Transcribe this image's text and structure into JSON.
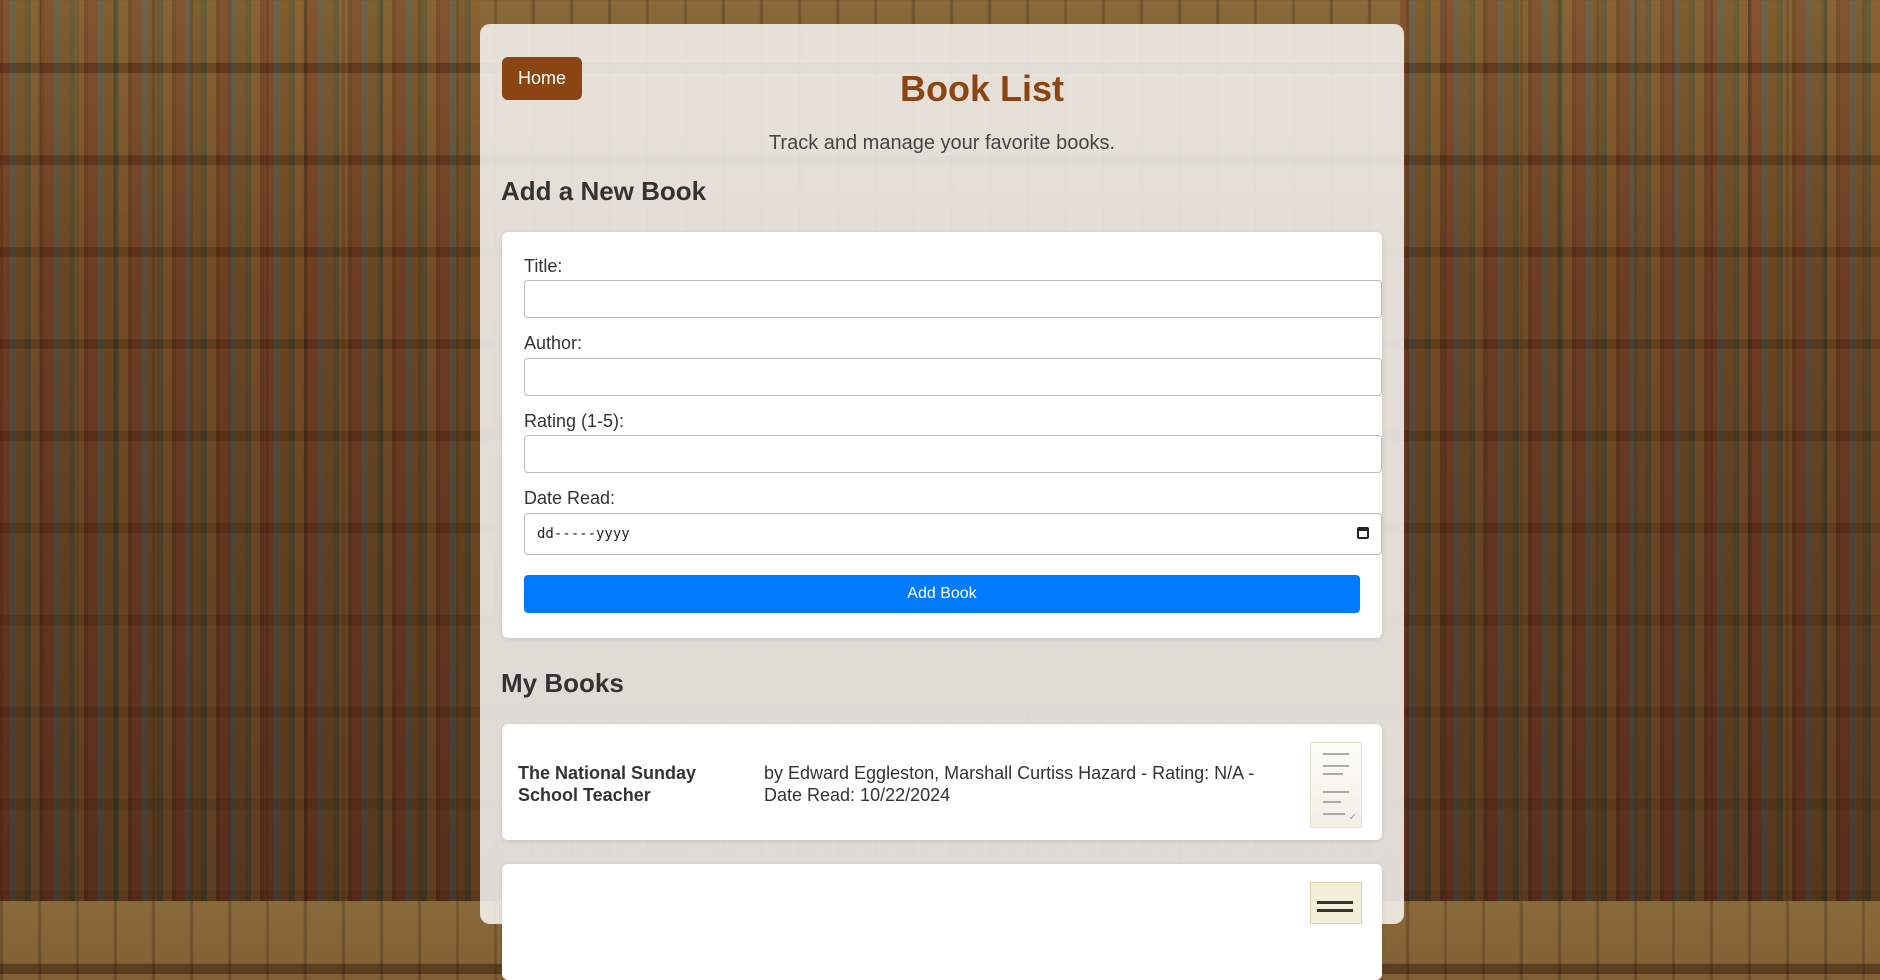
{
  "nav": {
    "home_label": "Home"
  },
  "header": {
    "title": "Book List",
    "subtitle": "Track and manage your favorite books."
  },
  "add_form": {
    "heading": "Add a New Book",
    "title_label": "Title:",
    "title_value": "",
    "author_label": "Author:",
    "author_value": "",
    "rating_label": "Rating (1-5):",
    "rating_value": "",
    "date_label": "Date Read:",
    "date_placeholder": "dd-----yyyy",
    "submit_label": "Add Book"
  },
  "my_books": {
    "heading": "My Books",
    "books": [
      {
        "title": "The National Sunday School Teacher",
        "meta": "by Edward Eggleston, Marshall Curtiss Hazard - Rating: N/A - Date Read: 10/22/2024",
        "cover_icon": "book-cover-thumbnail"
      },
      {
        "cover_icon": "book-cover-thumbnail"
      }
    ]
  },
  "colors": {
    "brand": "#8b4513",
    "primary_button": "#007bff",
    "panel": "#f5f3f0"
  }
}
